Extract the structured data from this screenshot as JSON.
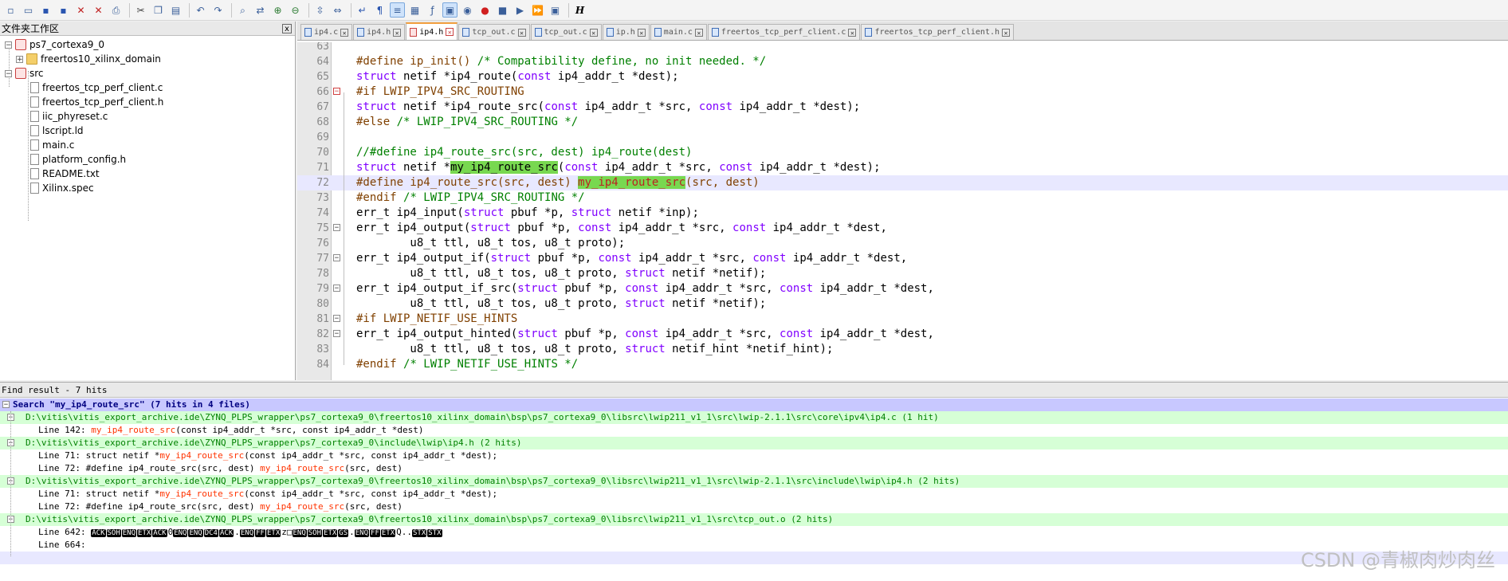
{
  "toolbar": {
    "icons": [
      "new-file-icon",
      "open-file-icon",
      "save-icon",
      "save-all-icon",
      "close-icon",
      "close-all-icon",
      "print-icon",
      "cut-icon",
      "copy-icon",
      "paste-icon",
      "undo-icon",
      "redo-icon",
      "find-icon",
      "replace-icon",
      "zoom-in-icon",
      "zoom-out-icon",
      "sync-vertical-icon",
      "sync-horizontal-icon",
      "word-wrap-icon",
      "show-all-chars-icon",
      "indent-guide-icon",
      "document-map-icon",
      "function-list-icon",
      "folder-workspace-icon",
      "monitoring-icon",
      "record-macro-icon",
      "stop-recording-icon",
      "play-macro-icon",
      "run-macro-multiple-icon",
      "save-macro-icon"
    ],
    "last_label": "H"
  },
  "left_panel": {
    "title": "文件夹工作区",
    "close_label": "x",
    "tree": [
      {
        "label": "ps7_cortexa9_0",
        "kind": "project",
        "expander": "−"
      },
      {
        "label": "freertos10_xilinx_domain",
        "kind": "folder",
        "expander": "+"
      },
      {
        "label": "src",
        "kind": "project",
        "expander": "−"
      },
      {
        "label": "freertos_tcp_perf_client.c",
        "kind": "file"
      },
      {
        "label": "freertos_tcp_perf_client.h",
        "kind": "file"
      },
      {
        "label": "iic_phyreset.c",
        "kind": "file"
      },
      {
        "label": "lscript.ld",
        "kind": "file"
      },
      {
        "label": "main.c",
        "kind": "file"
      },
      {
        "label": "platform_config.h",
        "kind": "file"
      },
      {
        "label": "README.txt",
        "kind": "file"
      },
      {
        "label": "Xilinx.spec",
        "kind": "file"
      }
    ]
  },
  "editor": {
    "tabs": [
      {
        "label": "ip4.c",
        "active": false
      },
      {
        "label": "ip4.h",
        "active": false
      },
      {
        "label": "ip4.h",
        "active": true
      },
      {
        "label": "tcp_out.c",
        "active": false
      },
      {
        "label": "tcp_out.c",
        "active": false
      },
      {
        "label": "ip.h",
        "active": false
      },
      {
        "label": "main.c",
        "active": false
      },
      {
        "label": "freertos_tcp_perf_client.c",
        "active": false
      },
      {
        "label": "freertos_tcp_perf_client.h",
        "active": false
      }
    ],
    "lines": [
      {
        "n": "63",
        "fold": "",
        "cur": false,
        "parts": []
      },
      {
        "n": "64",
        "fold": "",
        "cur": false,
        "parts": [
          [
            "pp",
            "#define ip_init() "
          ],
          [
            "cm",
            "/* Compatibility define, no init needed. */"
          ]
        ]
      },
      {
        "n": "65",
        "fold": "",
        "cur": false,
        "parts": [
          [
            "kw",
            "struct"
          ],
          [
            "",
            "netif *ip4_route("
          ],
          [
            "kw",
            "const"
          ],
          [
            "",
            "ip4_addr_t *dest);"
          ]
        ]
      },
      {
        "n": "66",
        "fold": "red",
        "cur": false,
        "parts": [
          [
            "pp",
            "#if LWIP_IPV4_SRC_ROUTING"
          ]
        ]
      },
      {
        "n": "67",
        "fold": "",
        "cur": false,
        "parts": [
          [
            "kw",
            "struct"
          ],
          [
            "",
            "netif *ip4_route_src("
          ],
          [
            "kw",
            "const"
          ],
          [
            "",
            "ip4_addr_t *src, "
          ],
          [
            "kw",
            "const"
          ],
          [
            "",
            "ip4_addr_t *dest);"
          ]
        ]
      },
      {
        "n": "68",
        "fold": "",
        "cur": false,
        "parts": [
          [
            "pp",
            "#else "
          ],
          [
            "cm",
            "/* LWIP_IPV4_SRC_ROUTING */"
          ]
        ]
      },
      {
        "n": "69",
        "fold": "",
        "cur": false,
        "parts": []
      },
      {
        "n": "70",
        "fold": "",
        "cur": false,
        "parts": [
          [
            "cm",
            "//#define ip4_route_src(src, dest) ip4_route(dest)"
          ]
        ]
      },
      {
        "n": "71",
        "fold": "",
        "cur": false,
        "parts": [
          [
            "kw",
            "struct"
          ],
          [
            "",
            "netif *"
          ],
          [
            "hl",
            "my_ip4_route_src"
          ],
          [
            "",
            "("
          ],
          [
            "kw",
            "const"
          ],
          [
            "",
            "ip4_addr_t *src, "
          ],
          [
            "kw",
            "const"
          ],
          [
            "",
            "ip4_addr_t *dest);"
          ]
        ]
      },
      {
        "n": "72",
        "fold": "",
        "cur": true,
        "parts": [
          [
            "pp",
            "#define ip4_route_src(src, dest) "
          ],
          [
            "hlpp",
            "my_ip4_route_src"
          ],
          [
            "pp",
            "(src, dest)"
          ]
        ]
      },
      {
        "n": "73",
        "fold": "",
        "cur": false,
        "parts": [
          [
            "pp",
            "#endif "
          ],
          [
            "cm",
            "/* LWIP_IPV4_SRC_ROUTING */"
          ]
        ]
      },
      {
        "n": "74",
        "fold": "",
        "cur": false,
        "parts": [
          [
            "",
            "err_t ip4_input("
          ],
          [
            "kw",
            "struct"
          ],
          [
            "",
            "pbuf *p, "
          ],
          [
            "kw",
            "struct"
          ],
          [
            "",
            "netif *inp);"
          ]
        ]
      },
      {
        "n": "75",
        "fold": "box",
        "cur": false,
        "parts": [
          [
            "",
            "err_t ip4_output("
          ],
          [
            "kw",
            "struct"
          ],
          [
            "",
            "pbuf *p, "
          ],
          [
            "kw",
            "const"
          ],
          [
            "",
            "ip4_addr_t *src, "
          ],
          [
            "kw",
            "const"
          ],
          [
            "",
            "ip4_addr_t *dest,"
          ]
        ]
      },
      {
        "n": "76",
        "fold": "",
        "cur": false,
        "parts": [
          [
            "",
            "        u8_t ttl, u8_t tos, u8_t proto);"
          ]
        ]
      },
      {
        "n": "77",
        "fold": "box",
        "cur": false,
        "parts": [
          [
            "",
            "err_t ip4_output_if("
          ],
          [
            "kw",
            "struct"
          ],
          [
            "",
            "pbuf *p, "
          ],
          [
            "kw",
            "const"
          ],
          [
            "",
            "ip4_addr_t *src, "
          ],
          [
            "kw",
            "const"
          ],
          [
            "",
            "ip4_addr_t *dest,"
          ]
        ]
      },
      {
        "n": "78",
        "fold": "",
        "cur": false,
        "parts": [
          [
            "",
            "        u8_t ttl, u8_t tos, u8_t proto, "
          ],
          [
            "kw",
            "struct"
          ],
          [
            "",
            "netif *netif);"
          ]
        ]
      },
      {
        "n": "79",
        "fold": "box",
        "cur": false,
        "parts": [
          [
            "",
            "err_t ip4_output_if_src("
          ],
          [
            "kw",
            "struct"
          ],
          [
            "",
            "pbuf *p, "
          ],
          [
            "kw",
            "const"
          ],
          [
            "",
            "ip4_addr_t *src, "
          ],
          [
            "kw",
            "const"
          ],
          [
            "",
            "ip4_addr_t *dest,"
          ]
        ]
      },
      {
        "n": "80",
        "fold": "",
        "cur": false,
        "parts": [
          [
            "",
            "        u8_t ttl, u8_t tos, u8_t proto, "
          ],
          [
            "kw",
            "struct"
          ],
          [
            "",
            "netif *netif);"
          ]
        ]
      },
      {
        "n": "81",
        "fold": "box",
        "cur": false,
        "parts": [
          [
            "pp",
            "#if LWIP_NETIF_USE_HINTS"
          ]
        ]
      },
      {
        "n": "82",
        "fold": "box",
        "cur": false,
        "parts": [
          [
            "",
            "err_t ip4_output_hinted("
          ],
          [
            "kw",
            "struct"
          ],
          [
            "",
            "pbuf *p, "
          ],
          [
            "kw",
            "const"
          ],
          [
            "",
            "ip4_addr_t *src, "
          ],
          [
            "kw",
            "const"
          ],
          [
            "",
            "ip4_addr_t *dest,"
          ]
        ]
      },
      {
        "n": "83",
        "fold": "",
        "cur": false,
        "parts": [
          [
            "",
            "        u8_t ttl, u8_t tos, u8_t proto, "
          ],
          [
            "kw",
            "struct"
          ],
          [
            "",
            "netif_hint *netif_hint);"
          ]
        ]
      },
      {
        "n": "84",
        "fold": "",
        "cur": false,
        "parts": [
          [
            "pp",
            "#endif "
          ],
          [
            "cm",
            "/* LWIP_NETIF_USE_HINTS */"
          ]
        ]
      }
    ]
  },
  "find_result": {
    "title": "Find result - 7 hits",
    "rows": [
      {
        "type": "search",
        "box": "−",
        "text": "Search \"my_ip4_route_src\" (7 hits in 4 files)"
      },
      {
        "type": "file",
        "box": "−",
        "text": "D:\\vitis\\vitis_export_archive.ide\\ZYNQ_PLPS_wrapper\\ps7_cortexa9_0\\freertos10_xilinx_domain\\bsp\\ps7_cortexa9_0\\libsrc\\lwip211_v1_1\\src\\lwip-2.1.1\\src\\core\\ipv4\\ip4.c (1 hit)"
      },
      {
        "type": "hit",
        "prefix": "Line 142: ",
        "match": "my_ip4_route_src",
        "suffix": "(const ip4_addr_t *src, const ip4_addr_t *dest)"
      },
      {
        "type": "file",
        "box": "−",
        "text": "D:\\vitis\\vitis_export_archive.ide\\ZYNQ_PLPS_wrapper\\ps7_cortexa9_0\\include\\lwip\\ip4.h (2 hits)"
      },
      {
        "type": "hit",
        "prefix": "Line 71: struct netif *",
        "match": "my_ip4_route_src",
        "suffix": "(const ip4_addr_t *src, const ip4_addr_t *dest);"
      },
      {
        "type": "hit",
        "prefix": "Line 72: #define ip4_route_src(src, dest) ",
        "match": "my_ip4_route_src",
        "suffix": "(src, dest)"
      },
      {
        "type": "file",
        "box": "−",
        "text": "D:\\vitis\\vitis_export_archive.ide\\ZYNQ_PLPS_wrapper\\ps7_cortexa9_0\\freertos10_xilinx_domain\\bsp\\ps7_cortexa9_0\\libsrc\\lwip211_v1_1\\src\\lwip-2.1.1\\src\\include\\lwip\\ip4.h (2 hits)"
      },
      {
        "type": "hit",
        "prefix": "Line 71: struct netif *",
        "match": "my_ip4_route_src",
        "suffix": "(const ip4_addr_t *src, const ip4_addr_t *dest);"
      },
      {
        "type": "hit",
        "prefix": "Line 72: #define ip4_route_src(src, dest) ",
        "match": "my_ip4_route_src",
        "suffix": "(src, dest)"
      },
      {
        "type": "file",
        "box": "−",
        "text": "D:\\vitis\\vitis_export_archive.ide\\ZYNQ_PLPS_wrapper\\ps7_cortexa9_0\\freertos10_xilinx_domain\\bsp\\ps7_cortexa9_0\\libsrc\\lwip211_v1_1\\src\\tcp_out.o (2 hits)"
      },
      {
        "type": "binary",
        "prefix": "Line 642: ",
        "tokens": [
          "ACK",
          "SOH",
          "ENQ",
          "ETX",
          "ACK",
          "0",
          "ENQ",
          "ENQ",
          "DC4",
          "ACK",
          ".",
          "ENQ",
          "FF",
          "ETX",
          "z□",
          "ENQ",
          "SOH",
          "ETX",
          "GS",
          ".",
          "ENQ",
          "FF",
          "ETX",
          "Q..",
          "STX",
          "STX"
        ]
      },
      {
        "type": "hit",
        "prefix": "Line 664:",
        "match": "",
        "suffix": ""
      },
      {
        "type": "empty"
      }
    ]
  },
  "watermark": "CSDN @青椒肉炒肉丝"
}
